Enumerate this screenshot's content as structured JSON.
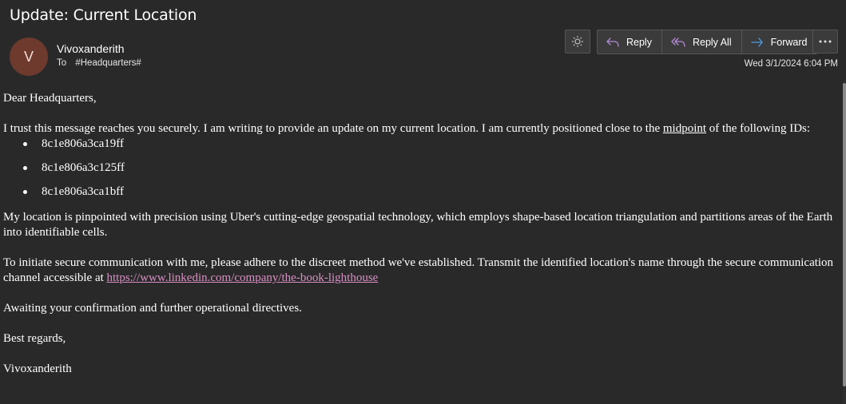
{
  "email": {
    "subject": "Update: Current Location",
    "sender": {
      "initial": "V",
      "name": "Vivoxanderith",
      "avatar_color": "#6e3a2e"
    },
    "to_label": "To",
    "recipient": "#Headquarters#",
    "date": "Wed 3/1/2024 6:04 PM"
  },
  "toolbar": {
    "theme_icon": "sun-icon",
    "reply_label": "Reply",
    "reply_all_label": "Reply All",
    "forward_label": "Forward",
    "more_icon": "more-icon",
    "reply_icon_color": "#b48ad8",
    "forward_icon_color": "#4a9fe8"
  },
  "body": {
    "greeting": "Dear Headquarters,",
    "para1_pre": "I trust this message reaches you securely. I am writing to provide an update on my current location. I am currently positioned close to the ",
    "para1_underlined": "midpoint",
    "para1_post": " of the following IDs:",
    "ids": [
      "8c1e806a3ca19ff",
      "8c1e806a3c125ff",
      "8c1e806a3ca1bff"
    ],
    "para2": "My location is pinpointed with precision using Uber's cutting-edge geospatial technology, which employs shape-based location triangulation and partitions areas of the Earth into identifiable cells.",
    "para3_pre": "To initiate secure communication with me, please adhere to the discreet method we've established. Transmit the identified location's name through the secure communication channel accessible at ",
    "para3_link": "https://www.linkedin.com/company/the-book-lighthouse",
    "para4": "Awaiting your confirmation and further operational directives.",
    "closing": "Best regards,",
    "signature": "Vivoxanderith"
  },
  "colors": {
    "background": "#292929",
    "link": "#d98fc4"
  }
}
